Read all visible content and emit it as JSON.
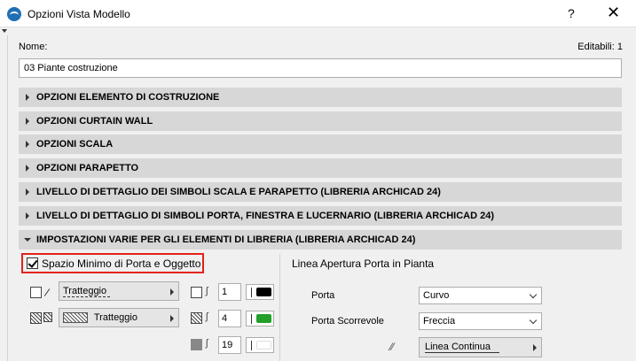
{
  "window": {
    "title": "Opzioni Vista Modello",
    "help_label": "?",
    "close_label": "✕"
  },
  "nome": {
    "label": "Nome:",
    "value": "03 Piante costruzione",
    "editabili": "Editabili: 1"
  },
  "sections": [
    {
      "label": "OPZIONI ELEMENTO DI COSTRUZIONE",
      "expanded": false
    },
    {
      "label": "OPZIONI CURTAIN WALL",
      "expanded": false
    },
    {
      "label": "OPZIONI SCALA",
      "expanded": false
    },
    {
      "label": "OPZIONI PARAPETTO",
      "expanded": false
    },
    {
      "label": "LIVELLO DI DETTAGLIO DEI SIMBOLI SCALA E PARAPETTO (LIBRERIA ARCHICAD 24)",
      "expanded": false
    },
    {
      "label": "LIVELLO DI DETTAGLIO DI SIMBOLI PORTA, FINESTRA E LUCERNARIO (LIBRERIA ARCHICAD 24)",
      "expanded": false
    },
    {
      "label": "IMPOSTAZIONI VARIE PER GLI ELEMENTI DI LIBRERIA (LIBRERIA ARCHICAD 24)",
      "expanded": true
    }
  ],
  "left": {
    "checkbox_label": "Spazio Minimo di Porta e Oggetto",
    "checked": true,
    "row1": {
      "dropdown": "Tratteggio",
      "pen": "1",
      "color": "#000000"
    },
    "row2": {
      "dropdown": "Tratteggio",
      "pen": "4",
      "color": "#22a02a"
    },
    "row3": {
      "pen": "19",
      "color": "#ffffff"
    }
  },
  "right": {
    "title": "Linea Apertura Porta in Pianta",
    "porta_label": "Porta",
    "porta_value": "Curvo",
    "scorrevole_label": "Porta Scorrevole",
    "scorrevole_value": "Freccia",
    "line_value": "Linea Continua"
  }
}
